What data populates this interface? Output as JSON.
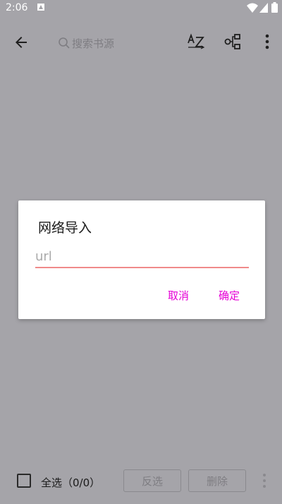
{
  "status_bar": {
    "time": "2:06"
  },
  "toolbar": {
    "search_placeholder": "搜索书源"
  },
  "dialog": {
    "title": "网络导入",
    "input_placeholder": "url",
    "input_value": "",
    "cancel_label": "取消",
    "confirm_label": "确定"
  },
  "bottom_bar": {
    "select_all_label": "全选（0/0）",
    "invert_label": "反选",
    "delete_label": "删除"
  },
  "colors": {
    "accent": "#e600d6",
    "underline": "#f08a8a",
    "scrim": "#a5a4a9"
  },
  "icons": [
    "back-arrow-icon",
    "search-icon",
    "sort-az-icon",
    "group-icon",
    "more-vert-icon"
  ]
}
